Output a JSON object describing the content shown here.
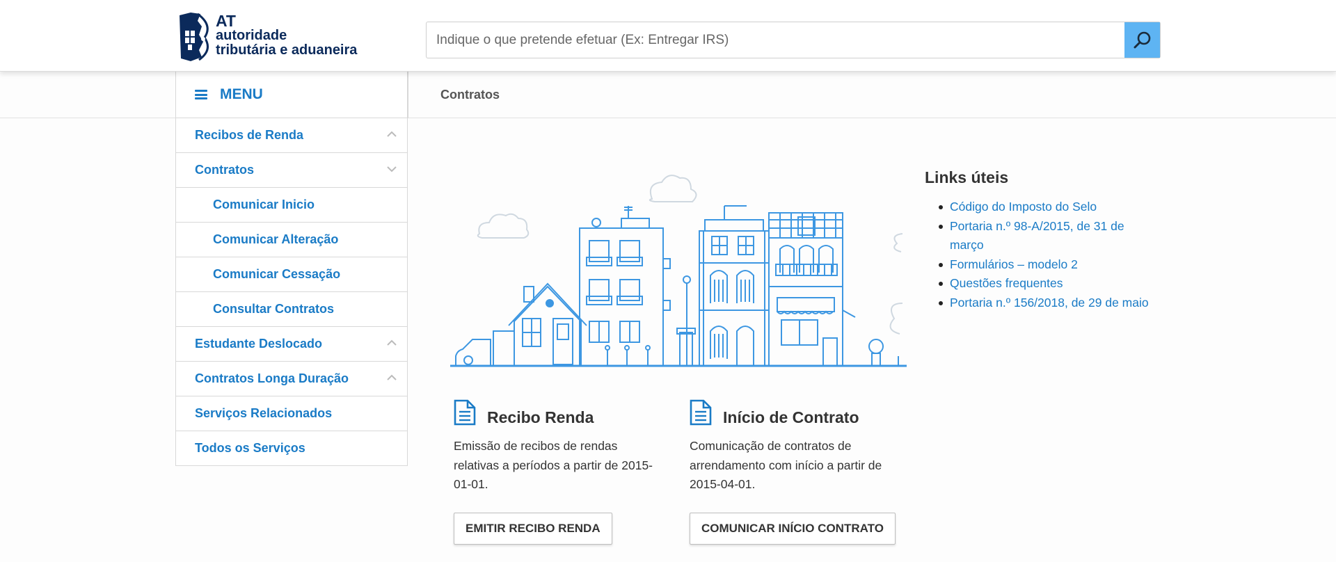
{
  "header": {
    "logo": {
      "line1": "AT",
      "line2": "autoridade",
      "line3": "tributária e aduaneira"
    },
    "search": {
      "placeholder": "Indique o que pretende efetuar (Ex: Entregar IRS)",
      "value": ""
    }
  },
  "menu": {
    "label": "MENU",
    "items": [
      {
        "label": "Recibos de Renda",
        "chevron": "up"
      },
      {
        "label": "Contratos",
        "chevron": "down"
      },
      {
        "label": "Comunicar Inicio"
      },
      {
        "label": "Comunicar Alteração"
      },
      {
        "label": "Comunicar Cessação"
      },
      {
        "label": "Consultar Contratos"
      },
      {
        "label": "Estudante Deslocado",
        "chevron": "up"
      },
      {
        "label": "Contratos Longa Duração",
        "chevron": "up"
      },
      {
        "label": "Serviços Relacionados"
      },
      {
        "label": "Todos os Serviços"
      }
    ]
  },
  "page": {
    "breadcrumb": "Contratos"
  },
  "cards": [
    {
      "icon": "document-icon",
      "title": "Recibo Renda",
      "description": "Emissão de recibos de rendas relativas a períodos a partir de 2015-01-01.",
      "button": "EMITIR RECIBO RENDA"
    },
    {
      "icon": "document-icon",
      "title": "Início de Contrato",
      "description": "Comunicação de contratos de arrendamento com início a partir de 2015-04-01.",
      "button": "COMUNICAR INÍCIO CONTRATO"
    }
  ],
  "links": {
    "title": "Links úteis",
    "items": [
      "Código do Imposto do Selo",
      "Portaria n.º 98-A/2015, de 31 de março",
      "Formulários – modelo 2",
      "Questões frequentes",
      "Portaria n.º 156/2018, de 29 de maio"
    ]
  },
  "colors": {
    "accent": "#1a7bc6",
    "search_button": "#5eb4f3",
    "illustration": "#3d97e2",
    "logo": "#0b2a5b"
  }
}
